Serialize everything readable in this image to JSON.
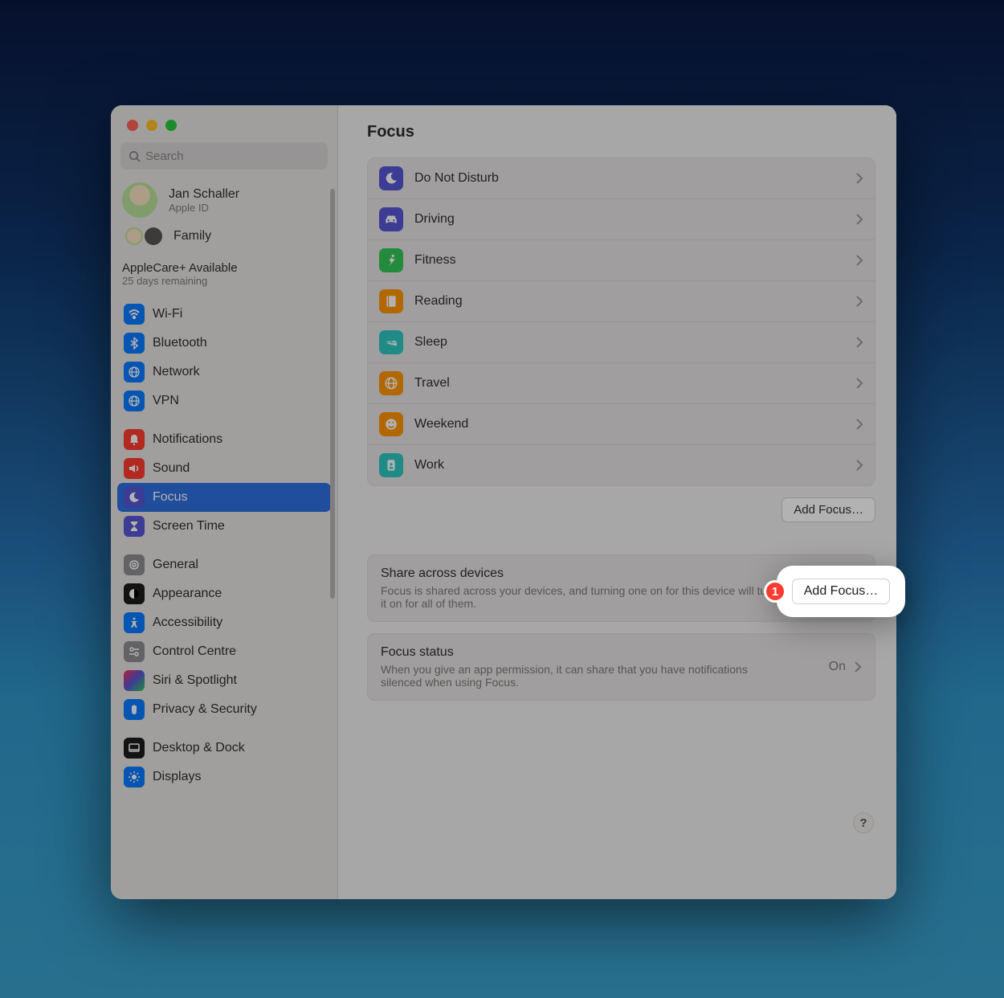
{
  "window": {
    "title": "Focus"
  },
  "search": {
    "placeholder": "Search"
  },
  "user": {
    "name": "Jan Schaller",
    "sub": "Apple ID"
  },
  "family": {
    "label": "Family"
  },
  "applecare": {
    "title": "AppleCare+ Available",
    "sub": "25 days remaining"
  },
  "sidebar": {
    "items": [
      {
        "label": "Wi-Fi"
      },
      {
        "label": "Bluetooth"
      },
      {
        "label": "Network"
      },
      {
        "label": "VPN"
      },
      {
        "label": "Notifications"
      },
      {
        "label": "Sound"
      },
      {
        "label": "Focus"
      },
      {
        "label": "Screen Time"
      },
      {
        "label": "General"
      },
      {
        "label": "Appearance"
      },
      {
        "label": "Accessibility"
      },
      {
        "label": "Control Centre"
      },
      {
        "label": "Siri & Spotlight"
      },
      {
        "label": "Privacy & Security"
      },
      {
        "label": "Desktop & Dock"
      },
      {
        "label": "Displays"
      }
    ]
  },
  "focus_modes": [
    {
      "label": "Do Not Disturb"
    },
    {
      "label": "Driving"
    },
    {
      "label": "Fitness"
    },
    {
      "label": "Reading"
    },
    {
      "label": "Sleep"
    },
    {
      "label": "Travel"
    },
    {
      "label": "Weekend"
    },
    {
      "label": "Work"
    }
  ],
  "add_focus": {
    "label": "Add Focus…"
  },
  "share": {
    "title": "Share across devices",
    "desc": "Focus is shared across your devices, and turning one on for this device will turn it on for all of them.",
    "on": true
  },
  "status": {
    "title": "Focus status",
    "desc": "When you give an app permission, it can share that you have notifications silenced when using Focus.",
    "value": "On"
  },
  "help": "?",
  "callout": {
    "number": "1"
  }
}
